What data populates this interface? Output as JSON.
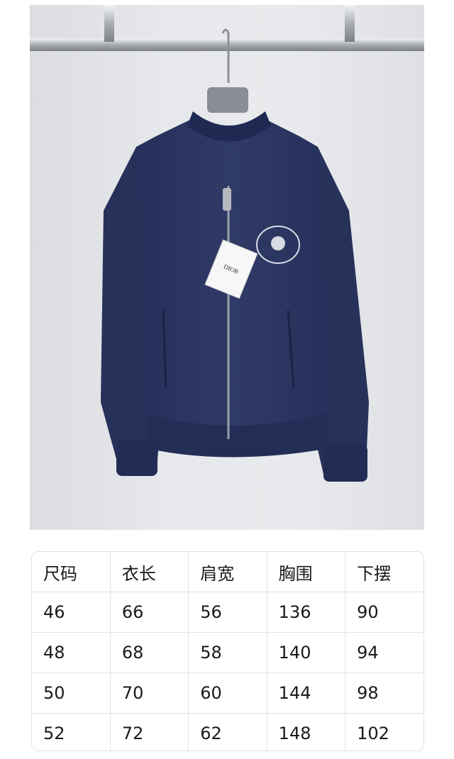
{
  "product_photo": {
    "description_icon": "jacket-photo",
    "tag_text": "DIOR",
    "colors": {
      "jacket": "#2b3760",
      "jacket_shadow": "#1e2849",
      "wall": "#e6e7ea",
      "rail": "#b8bcc2"
    }
  },
  "size_table": {
    "headers": [
      "尺码",
      "衣长",
      "肩宽",
      "胸围",
      "下摆"
    ],
    "rows": [
      [
        "46",
        "66",
        "56",
        "136",
        "90"
      ],
      [
        "48",
        "68",
        "58",
        "140",
        "94"
      ],
      [
        "50",
        "70",
        "60",
        "144",
        "98"
      ],
      [
        "52",
        "72",
        "62",
        "148",
        "102"
      ]
    ]
  }
}
